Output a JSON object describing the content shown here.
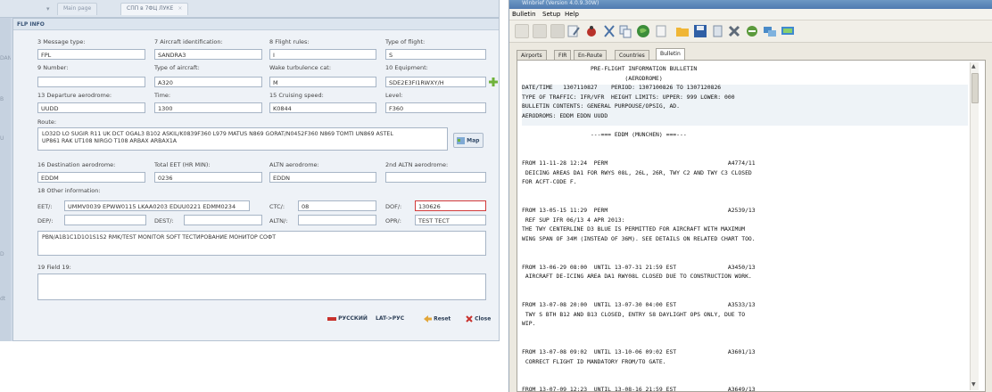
{
  "left": {
    "tabs": {
      "page1": "Main page",
      "page2": "СПП в 7ФЦ ЛУКЕ",
      "close": "×"
    },
    "side_letters": [
      "DANI",
      "B",
      "U",
      "D",
      "dt"
    ],
    "panel_title": "FLP INFO",
    "fields": {
      "message_type": {
        "label": "3 Message type:",
        "value": "FPL"
      },
      "aircraft_id": {
        "label": "7 Aircraft identification:",
        "value": "SANDRA3"
      },
      "flight_rules": {
        "label": "8 Flight rules:",
        "value": "I"
      },
      "type_of_flight": {
        "label": "Type of flight:",
        "value": "S"
      },
      "number": {
        "label": "9 Number:",
        "value": ""
      },
      "type_of_aircraft": {
        "label": "Type of aircraft:",
        "value": "A320"
      },
      "wake_turbulence": {
        "label": "Wake turbulence cat:",
        "value": "M"
      },
      "equipment": {
        "label": "10 Equipment:",
        "value": "SDE2E3FI1RWXY/H"
      },
      "departure": {
        "label": "13 Departure aerodrome:",
        "value": "UUDD"
      },
      "time": {
        "label": "Time:",
        "value": "1300"
      },
      "cruising_speed": {
        "label": "15 Cruising speed:",
        "value": "K0844"
      },
      "level": {
        "label": "Level:",
        "value": "F360"
      },
      "route": {
        "label": "Route:",
        "value_line1": "LO32D LO SUGIR R11 UK DCT OGAL3 B102 ASKIL/K0839F360 L979 MATUS N869 GORAT/N0452F360 N869 TOMTI UN869 ASTEL",
        "value_line2": "UP861 RAK UT108 NIRGO T108 ARBAX ARBAX1A"
      },
      "destination": {
        "label": "16 Destination aerodrome:",
        "value": "EDDM"
      },
      "total_eet": {
        "label": "Total EET (HR MIN):",
        "value": "0236"
      },
      "altn": {
        "label": "ALTN aerodrome:",
        "value": "EDDN"
      },
      "altn2": {
        "label": "2nd ALTN aerodrome:",
        "value": ""
      },
      "other_info": {
        "label": "18 Other information:"
      },
      "eet": {
        "label": "EET/:",
        "value": "UMMV0039 EPWW0115 LKAA0203 EDUU0221 EDMM0234"
      },
      "ctc": {
        "label": "CTC/:",
        "value": "08"
      },
      "dof": {
        "label": "DOF/:",
        "value": "130626"
      },
      "dep": {
        "label": "DEP/:",
        "value": ""
      },
      "dest": {
        "label": "DEST/:",
        "value": ""
      },
      "altn_slash": {
        "label": "ALTN/:",
        "value": ""
      },
      "opr": {
        "label": "OPR/:",
        "value": "TEST TECT"
      },
      "pbn": {
        "value": "PBN/A1B1C1D1O1S1S2 RMK/TEST MONITOR SOFT ТЕСТИРОВАНИЕ МОНИТОР СОФТ"
      },
      "field19": {
        "label": "19 Field 19:",
        "value": ""
      }
    },
    "buttons": {
      "map": "Map",
      "russian": "РУССКИЙ",
      "lat": "LAT->РУС",
      "reset": "Reset",
      "close": "Close"
    }
  },
  "right": {
    "title": "Winbrief (Version 4.0.9.30W)",
    "menu": [
      "Bulletin",
      "Setup",
      "Help"
    ],
    "tabs": [
      "Airports",
      "FIR",
      "En-Route",
      "Countries",
      "Bulletin"
    ],
    "bulletin": [
      "                    PRE-FLIGHT INFORMATION BULLETIN",
      "                              (AERODROME)",
      "DATE/TIME   1307110827    PERIOD: 1307100826 TO 1307120826",
      "TYPE OF TRAFFIC: IFR/VFR  HEIGHT LIMITS: UPPER: 999 LOWER: 000",
      "BULLETIN CONTENTS: GENERAL PURPOUSE/OPSIG, AD.",
      "AERODROMS: EDDM EDDN UUDD",
      "",
      "                    ---=== EDDM (MUNCHEN) ===---",
      "",
      "",
      "FROM 11-11-28 12:24  PERM                                   A4774/11",
      " DEICING AREAS DA1 FOR RWYS 08L, 26L, 26R, TWY C2 AND TWY C3 CLOSED",
      "FOR ACFT-CODE F.",
      "",
      "",
      "FROM 13-05-15 11:29  PERM                                   A2539/13",
      " REF SUP IFR 06/13 4 APR 2013:",
      "THE TWY CENTERLINE D3 BLUE IS PERMITTED FOR AIRCRAFT WITH MAXIMUM",
      "WING SPAN OF 34M (INSTEAD OF 36M). SEE DETAILS ON RELATED CHART TOO.",
      "",
      "",
      "FROM 13-06-29 08:00  UNTIL 13-07-31 21:59 EST               A3450/13",
      " AIRCRAFT DE-ICING AREA DA1 RWY08L CLOSED DUE TO CONSTRUCTION WORK.",
      "",
      "",
      "FROM 13-07-08 20:00  UNTIL 13-07-30 04:00 EST               A3533/13",
      " TWY S BTH B12 AND B13 CLOSED, ENTRY S8 DAYLIGHT OPS ONLY, DUE TO",
      "WIP.",
      "",
      "",
      "FROM 13-07-08 09:02  UNTIL 13-10-06 09:02 EST               A3601/13",
      " CORRECT FLIGHT ID MANDATORY FROM/TO GATE.",
      "",
      "",
      "FROM 13-07-09 12:23  UNTIL 13-08-16 21:59 EST               A3649/13"
    ]
  },
  "colors": {
    "accent_green": "#6fb23a",
    "red_flag": "#c8312c",
    "panel_bg": "#eef2f7",
    "titlebar": "#5a86b8"
  }
}
